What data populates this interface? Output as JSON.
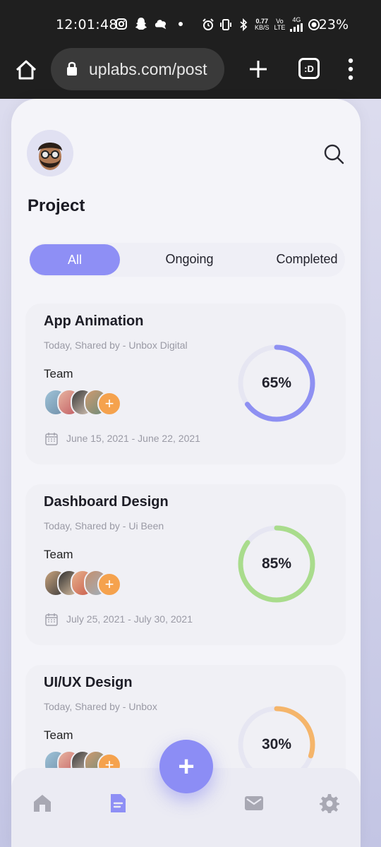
{
  "status_bar": {
    "time": "12:01:48",
    "net_speed_value": "0.77",
    "net_speed_unit": "KB/S",
    "volte_top": "Vo",
    "volte_bottom": "LTE",
    "signal_label": "4G",
    "battery": "23%"
  },
  "browser": {
    "url": "uplabs.com/post",
    "tabs_label": ":D"
  },
  "app": {
    "title": "Project",
    "tabs": [
      {
        "label": "All"
      },
      {
        "label": "Ongoing"
      },
      {
        "label": "Completed"
      }
    ],
    "projects": [
      {
        "title": "App Animation",
        "subtitle": "Today, Shared by - Unbox Digital",
        "team_label": "Team",
        "date_range": "June 15, 2021 - June 22, 2021",
        "progress_label": "65%",
        "progress": 0.65,
        "color": "#8e90f2"
      },
      {
        "title": "Dashboard Design",
        "subtitle": "Today, Shared by - Ui Been",
        "team_label": "Team",
        "date_range": "July 25, 2021 - July 30, 2021",
        "progress_label": "85%",
        "progress": 0.85,
        "color": "#a9dc8c"
      },
      {
        "title": "UI/UX Design",
        "subtitle": "Today, Shared by - Unbox",
        "team_label": "Team",
        "date_range": "",
        "progress_label": "30%",
        "progress": 0.3,
        "color": "#f5b56a"
      }
    ],
    "add_member_symbol": "+",
    "fab_symbol": "+",
    "nav_items": [
      {
        "icon": "home-icon"
      },
      {
        "icon": "document-icon"
      },
      {
        "icon": "mail-icon"
      },
      {
        "icon": "gear-icon"
      }
    ]
  },
  "colors": {
    "accent": "#8e8ff5",
    "add_member": "#f5a24d"
  }
}
